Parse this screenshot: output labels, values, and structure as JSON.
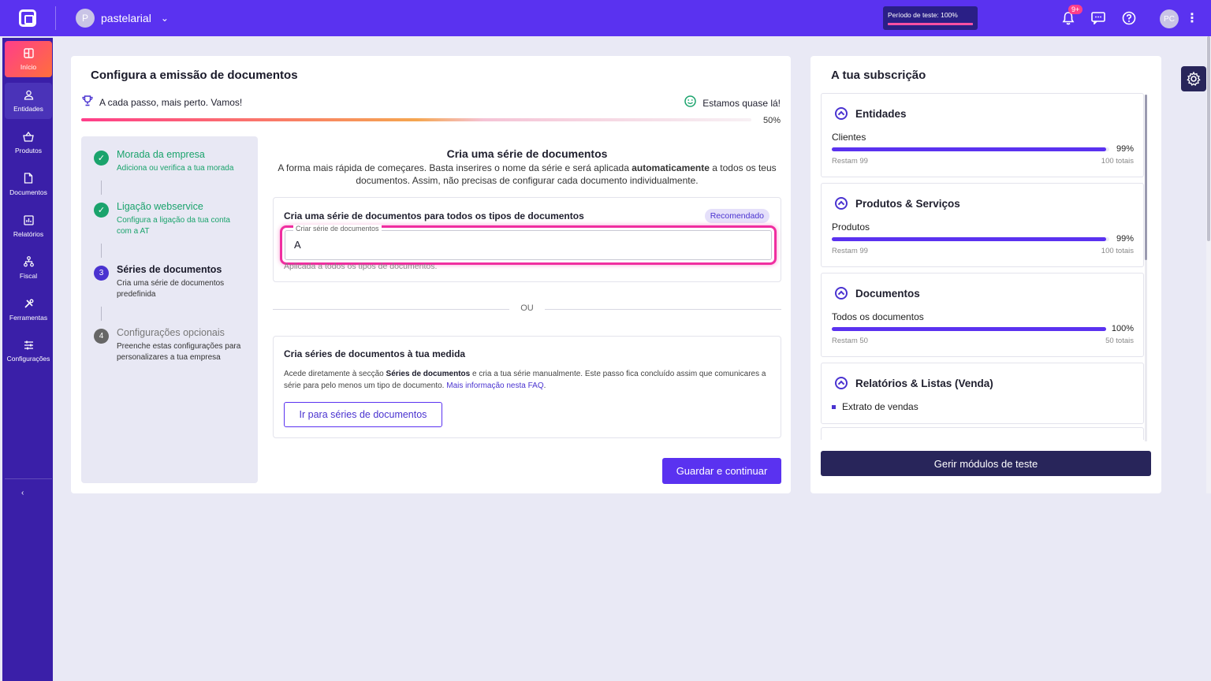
{
  "topbar": {
    "workspace_initial": "P",
    "workspace_name": "pastelarial",
    "trial_label": "Período de teste: 100%",
    "trial_progress": 1.0,
    "notif_badge": "9+",
    "user_initials": "PC"
  },
  "sidebar": {
    "items": [
      {
        "label": "Início",
        "icon": "grid-icon"
      },
      {
        "label": "Entidades",
        "icon": "user-icon"
      },
      {
        "label": "Produtos",
        "icon": "basket-icon"
      },
      {
        "label": "Documentos",
        "icon": "document-icon"
      },
      {
        "label": "Relatórios",
        "icon": "chart-icon"
      },
      {
        "label": "Fiscal",
        "icon": "hierarchy-icon"
      },
      {
        "label": "Ferramentas",
        "icon": "tools-icon"
      },
      {
        "label": "Configurações",
        "icon": "sliders-icon"
      }
    ]
  },
  "main": {
    "title": "Configura a emissão de documentos",
    "progress_left": "A cada passo, mais perto. Vamos!",
    "progress_right": "Estamos quase lá!",
    "progress_pct": "50%",
    "steps": [
      {
        "number": "",
        "title": "Morada da empresa",
        "desc": "Adiciona ou verifica a tua morada",
        "state": "done"
      },
      {
        "number": "",
        "title": "Ligação webservice",
        "desc": "Configura a ligação da tua conta com a AT",
        "state": "done"
      },
      {
        "number": "3",
        "title": "Séries de documentos",
        "desc": "Cria uma série de documentos predefinida",
        "state": "current"
      },
      {
        "number": "4",
        "title": "Configurações opcionais",
        "desc": "Preenche estas configurações para personalizares a tua empresa",
        "state": "pending"
      }
    ],
    "content_title": "Cria uma série de documentos",
    "content_desc_1": "A forma mais rápida de começares. Basta inserires o nome da série e será aplicada ",
    "content_desc_bold": "automaticamente",
    "content_desc_2": " a todos os teus documentos. Assim, não precisas de configurar cada documento individualmente.",
    "box1": {
      "title": "Cria uma série de documentos para todos os tipos de documentos",
      "badge": "Recomendado",
      "input_label": "Criar série de documentos",
      "input_value": "A",
      "help": "Aplicada a todos os tipos de documentos."
    },
    "separator": "OU",
    "box2": {
      "title": "Cria séries de documentos à tua medida",
      "desc_1": "Acede diretamente à secção ",
      "desc_bold": "Séries de documentos",
      "desc_2": " e cria a tua série manualmente. Este passo fica concluído assim que comunicares a série para pelo menos um tipo de documento. ",
      "desc_link": "Mais informação nesta FAQ",
      "desc_end": ".",
      "button": "Ir para séries de documentos"
    },
    "save_button": "Guardar e continuar"
  },
  "subscription": {
    "title": "A tua subscrição",
    "modules": [
      {
        "name": "Entidades",
        "label": "Clientes",
        "pct": "99%",
        "fill": 0.99,
        "rest": "Restam 99",
        "total": "100 totais"
      },
      {
        "name": "Produtos & Serviços",
        "label": "Produtos",
        "pct": "99%",
        "fill": 0.99,
        "rest": "Restam 99",
        "total": "100 totais"
      },
      {
        "name": "Documentos",
        "label": "Todos os documentos",
        "pct": "100%",
        "fill": 1.0,
        "rest": "Restam 50",
        "total": "50 totais"
      },
      {
        "name": "Relatórios & Listas (Venda)",
        "bullet": "Extrato de vendas"
      }
    ],
    "manage_button": "Gerir módulos de teste"
  },
  "colors": {
    "primary": "#5a32f0",
    "sidebar": "#3a1fa8",
    "accent_pink": "#ff3e8a",
    "success": "#1aa36c",
    "dark_button": "#28255a"
  }
}
